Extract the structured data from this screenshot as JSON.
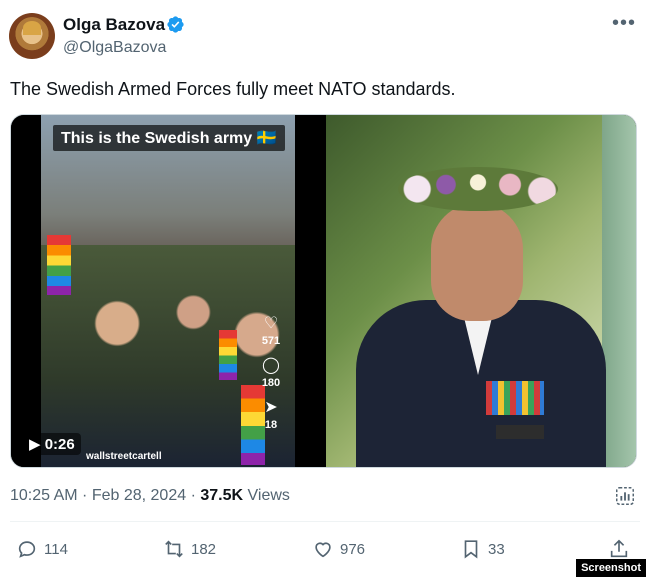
{
  "user": {
    "display_name": "Olga Bazova",
    "handle": "@OlgaBazova",
    "verified": true
  },
  "tweet": {
    "text": "The Swedish Armed Forces fully meet NATO standards."
  },
  "media": {
    "video": {
      "overlay_title": "This is the Swedish army 🇸🇪",
      "duration": "0:26",
      "watermark": "wallstreetcartell",
      "likes": "571",
      "comments": "180",
      "shares": "18"
    }
  },
  "meta": {
    "time": "10:25 AM",
    "date": "Feb 28, 2024",
    "views_count": "37.5K",
    "views_label": "Views"
  },
  "actions": {
    "replies": "114",
    "reposts": "182",
    "likes": "976",
    "bookmarks": "33"
  },
  "badge": "Screenshot",
  "colors": {
    "text": "#0f1419",
    "secondary": "#536471",
    "verified": "#1d9bf0"
  }
}
